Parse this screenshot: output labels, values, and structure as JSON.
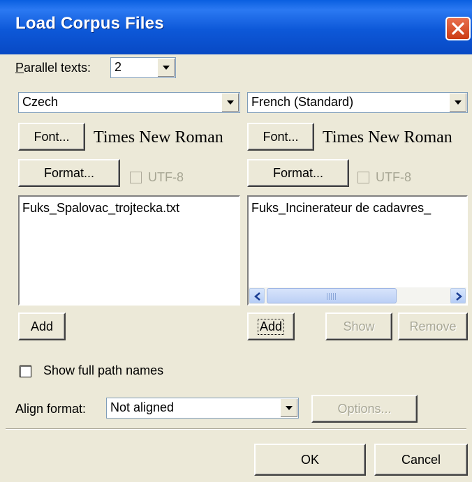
{
  "window": {
    "title": "Load Corpus Files"
  },
  "parallel": {
    "label": "Parallel texts:",
    "value": "2"
  },
  "left": {
    "language": "Czech",
    "font_button": "Font...",
    "font_name": "Times New Roman",
    "format_button": "Format...",
    "utf8_label": "UTF-8",
    "files": [
      "Fuks_Spalovac_trojtecka.txt"
    ],
    "add_button": "Add"
  },
  "right": {
    "language": "French (Standard)",
    "font_button": "Font...",
    "font_name": "Times New Roman",
    "format_button": "Format...",
    "utf8_label": "UTF-8",
    "files": [
      "Fuks_Incinerateur de cadavres_"
    ],
    "add_button": "Add",
    "show_button": "Show",
    "remove_button": "Remove"
  },
  "show_full_path": {
    "label": "Show full path names",
    "checked": false
  },
  "align": {
    "label": "Align format:",
    "value": "Not aligned",
    "options_button": "Options..."
  },
  "footer": {
    "ok": "OK",
    "cancel": "Cancel"
  },
  "colors": {
    "titlebar": "#0a5fe0",
    "dialog_bg": "#ece9d8",
    "close": "#d9502a"
  }
}
